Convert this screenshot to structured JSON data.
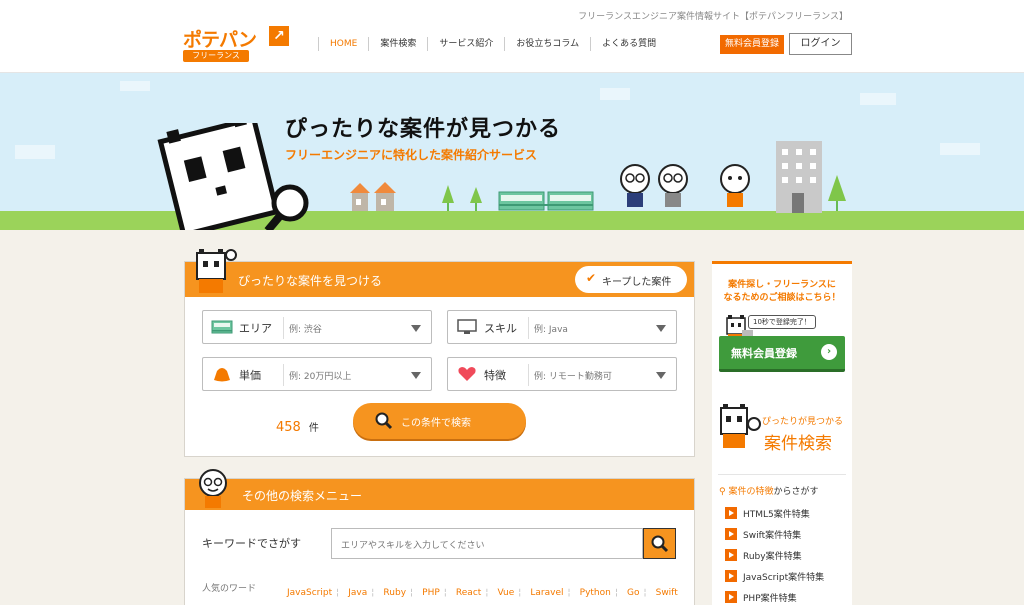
{
  "header": {
    "tagline": "フリーランスエンジニア案件情報サイト【ポテパンフリーランス】",
    "logo_main": "ポテパン",
    "logo_sub": "フリーランス",
    "nav": [
      "HOME",
      "案件検索",
      "サービス紹介",
      "お役立ちコラム",
      "よくある質問"
    ],
    "register_label": "無料会員登録",
    "login_label": "ログイン"
  },
  "hero": {
    "title": "ぴったりな案件が見つかる",
    "subtitle": "フリーエンジニアに特化した案件紹介サービス"
  },
  "search": {
    "title": "ぴったりな案件を見つける",
    "saved_label": "キープした案件",
    "fields": [
      {
        "label": "エリア",
        "placeholder": "例: 渋谷",
        "icon": "train-icon"
      },
      {
        "label": "スキル",
        "placeholder": "例: Java",
        "icon": "monitor-icon"
      },
      {
        "label": "単価",
        "placeholder": "例: 20万円以上",
        "icon": "money-bag-icon"
      },
      {
        "label": "特徴",
        "placeholder": "例: リモート勤務可",
        "icon": "heart-icon"
      }
    ],
    "count": "458",
    "count_unit": "件",
    "submit_label": "この条件で検索"
  },
  "other": {
    "title": "その他の検索メニュー",
    "keyword_label": "キーワードでさがす",
    "keyword_placeholder": "エリアやスキルを入力してください",
    "popular_label": "人気のワード",
    "popular_words": [
      "JavaScript",
      "Java",
      "Ruby",
      "PHP",
      "React",
      "Vue",
      "Laravel",
      "Python",
      "Go",
      "Swift"
    ]
  },
  "sidebar": {
    "consult_line1": "案件探し・フリーランスに",
    "consult_line2": "なるためのご相談はこちら！",
    "bubble": "10秒で登録完了！",
    "register_button": "無料会員登録",
    "search_small": "ぴったりが見つかる",
    "search_big": "案件検索",
    "feature_heading_orange": "案件の特徴",
    "feature_heading_rest": "からさがす",
    "features": [
      "HTML5案件特集",
      "Swift案件特集",
      "Ruby案件特集",
      "JavaScript案件特集",
      "PHP案件特集"
    ]
  },
  "colors": {
    "accent": "#f47a00",
    "header_bar": "#f6941f",
    "green_button": "#3f9b3c",
    "sky": "#d7eef9",
    "grass": "#9bd35a"
  }
}
